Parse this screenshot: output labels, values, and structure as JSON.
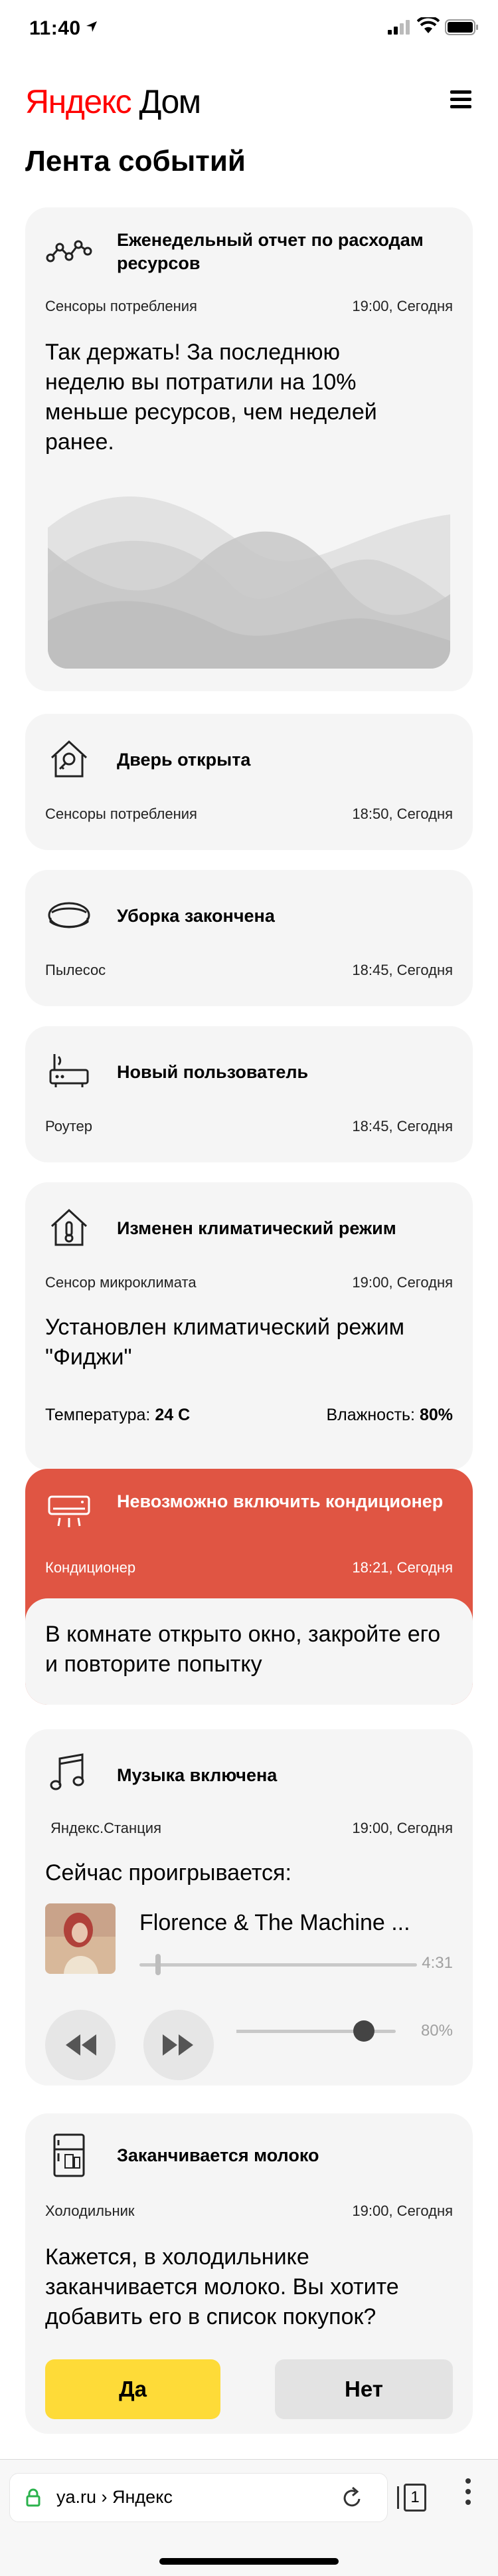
{
  "status_bar": {
    "time": "11:40"
  },
  "header": {
    "logo_part1": "Яндекс",
    "logo_part2": "Дом"
  },
  "page_title": "Лента событий",
  "cards": {
    "weekly": {
      "title": "Еженедельный отчет по расходам ресурсов",
      "source": "Сенсоры потребления",
      "time": "19:00, Сегодня",
      "body": "Так держать! За последнюю неделю вы потратили на 10% меньше ресурсов, чем неделей ранее."
    },
    "door": {
      "title": "Дверь открыта",
      "source": "Сенсоры потребления",
      "time": "18:50, Сегодня"
    },
    "vacuum": {
      "title": "Уборка закончена",
      "source": "Пылесос",
      "time": "18:45, Сегодня"
    },
    "router": {
      "title": "Новый пользователь",
      "source": "Роутер",
      "time": "18:45, Сегодня"
    },
    "climate": {
      "title": "Изменен климатический режим",
      "source": "Сенсор микроклимата",
      "time": "19:00, Сегодня",
      "body": "Установлен климатический режим \"Фиджи\"",
      "temp_label": "Температура:",
      "temp_value": "24 С",
      "humidity_label": "Влажность:",
      "humidity_value": "80%"
    },
    "ac": {
      "title": "Невозможно включить кондиционер",
      "source": "Кондиционер",
      "time": "18:21, Сегодня",
      "body": "В комнате открыто окно, закройте его и повторите попытку",
      "accent_color": "#e05543"
    },
    "music": {
      "title": "Музыка включена",
      "source": "Яндекс.Станция",
      "time": "19:00, Сегодня",
      "now_playing": "Сейчас проигрывается:",
      "track": "Florence & The Machine ...",
      "duration": "4:31",
      "volume": "80%",
      "volume_level": 0.8
    },
    "milk": {
      "title": "Заканчивается молоко",
      "source": "Холодильник",
      "time": "19:00, Сегодня",
      "body": "Кажется, в холодильнике заканчивается молоко. Вы хотите добавить его в список покупок?",
      "yes_label": "Да",
      "no_label": "Нет",
      "yes_color": "#fedb38"
    }
  },
  "browser": {
    "url": "ya.ru › Яндекс",
    "tabs_count": "1"
  }
}
